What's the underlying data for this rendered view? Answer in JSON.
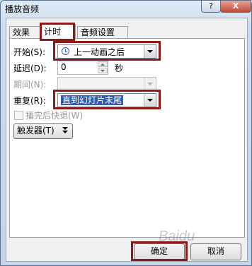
{
  "window": {
    "title": "播放音频",
    "help_label": "?",
    "close_label": "X"
  },
  "tabs": [
    {
      "label": "效果",
      "active": false
    },
    {
      "label": "计时",
      "active": true
    },
    {
      "label": "音频设置",
      "active": false
    }
  ],
  "form": {
    "start": {
      "label": "开始(S):",
      "value": "上一动画之后"
    },
    "delay": {
      "label": "延迟(D):",
      "value": "0",
      "unit": "秒"
    },
    "period": {
      "label": "期间(N):",
      "value": ""
    },
    "repeat": {
      "label": "重复(R):",
      "value": "直到幻灯片末尾"
    },
    "rewind": {
      "label": "播完后快退(W)",
      "checked": false
    },
    "trigger": {
      "label": "触发器(T)"
    }
  },
  "buttons": {
    "ok": "确定",
    "cancel": "取消"
  },
  "watermark": "Baidu",
  "highlight_color": "#8c1a1a"
}
